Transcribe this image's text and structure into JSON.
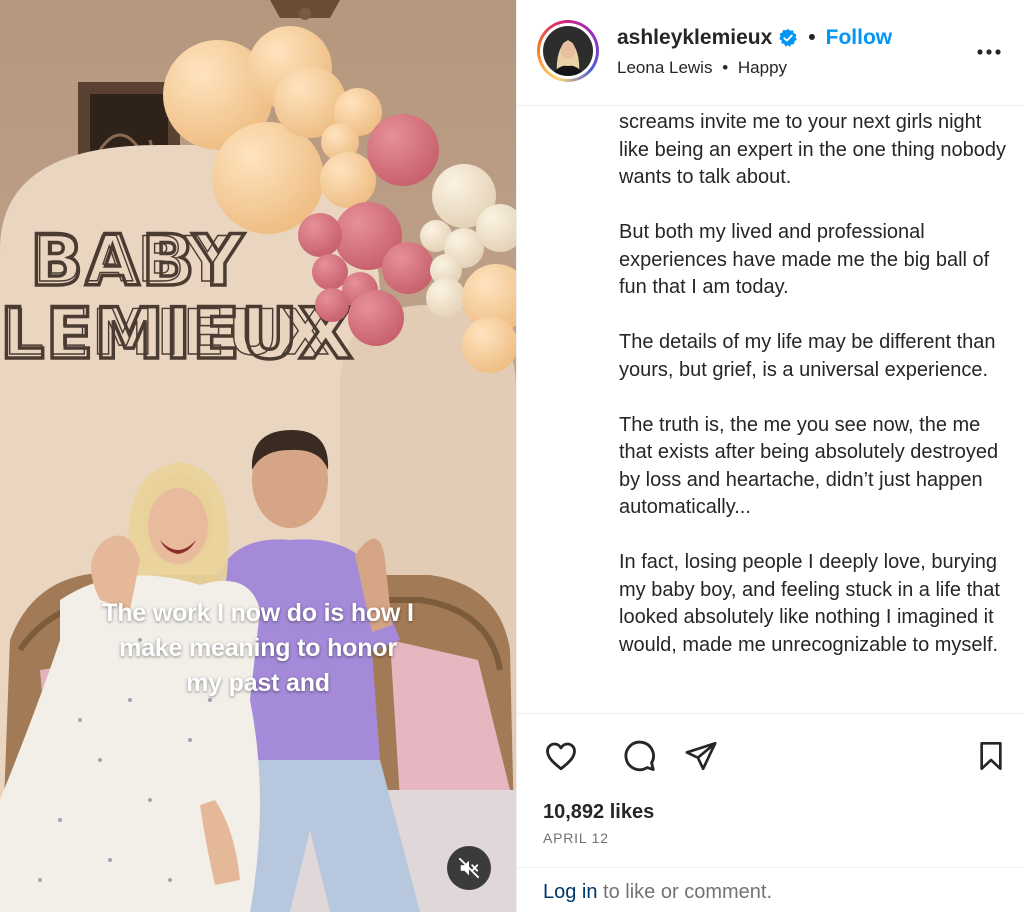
{
  "video": {
    "backdrop_text": [
      "BABY",
      "LEMIEUX"
    ],
    "caption_lines": [
      "The work I now do is how I",
      "make meaning to honor",
      "my past and"
    ],
    "mute_icon": "speaker-muted-icon"
  },
  "header": {
    "username": "ashleyklemieux",
    "verified_icon": "verified-badge-icon",
    "separator": "•",
    "follow_label": "Follow",
    "audio_artist": "Leona Lewis",
    "audio_separator": "•",
    "audio_track": "Happy",
    "more_icon": "more-options-icon"
  },
  "caption": {
    "paragraphs": [
      "screams invite me to your next girls night like being an expert in the one thing nobody wants to talk about.",
      "But both my lived and professional experiences have made me the big ball of fun that I am today.",
      "The details of my life may be different than yours, but grief, is a universal experience.",
      "The truth is, the me you see now, the me that exists after being absolutely destroyed by loss and heartache, didn’t just happen automatically...",
      "In fact, losing people I deeply love, burying my baby boy, and feeling stuck in a life that looked absolutely like nothing I imagined it would, made me unrecognizable to myself."
    ]
  },
  "actions": {
    "icons": [
      "heart-icon",
      "comment-icon",
      "share-icon",
      "bookmark-icon"
    ],
    "likes": "10,892 likes",
    "date": "APRIL 12"
  },
  "login": {
    "link_label": "Log in",
    "rest": " to like or comment."
  },
  "colors": {
    "accent": "#0095f6",
    "verified": "#0095f6",
    "muted_text": "#737373",
    "login_link": "#00376b"
  }
}
